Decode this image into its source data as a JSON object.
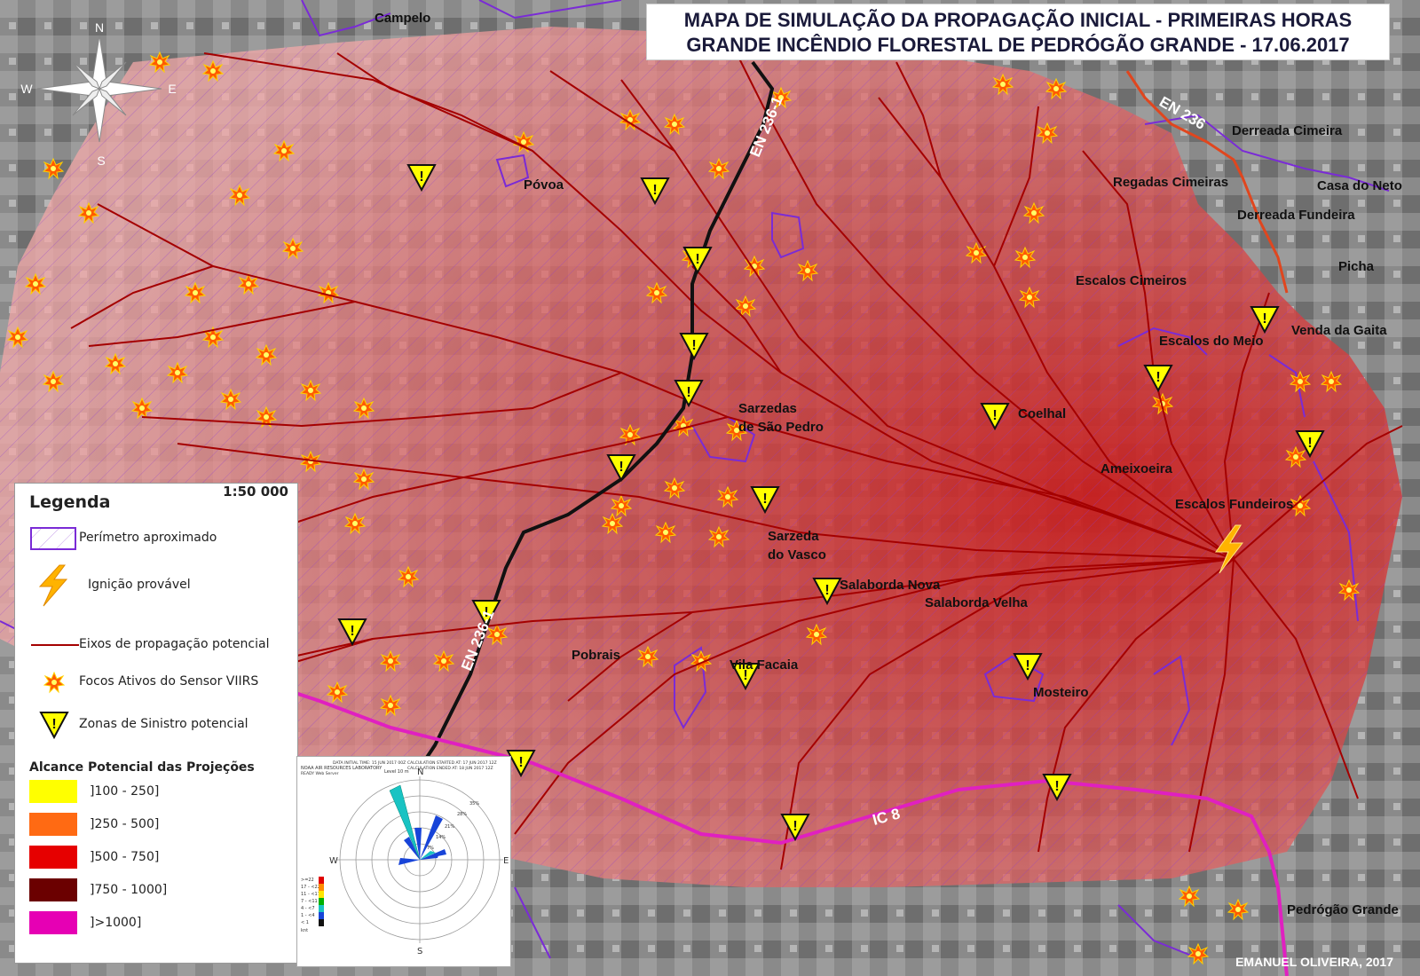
{
  "title": {
    "line1": "MAPA DE SIMULAÇÃO DA PROPAGAÇÃO INICIAL - PRIMEIRAS HORAS",
    "line2": "GRANDE INCÊNDIO FLORESTAL DE PEDRÓGÃO GRANDE - 17.06.2017"
  },
  "compass": {
    "n": "N",
    "s": "S",
    "e": "E",
    "w": "W"
  },
  "places": [
    {
      "name": "Campelo"
    },
    {
      "name": "Póvoa"
    },
    {
      "name": "Derreada Cimeira"
    },
    {
      "name": "Regadas Cimeiras"
    },
    {
      "name": "Casa do Neto"
    },
    {
      "name": "Derreada Fundeira"
    },
    {
      "name": "Picha"
    },
    {
      "name": "Escalos Cimeiros"
    },
    {
      "name": "Escalos do Meio"
    },
    {
      "name": "Venda da Gaita"
    },
    {
      "name": "Sarzedas"
    },
    {
      "name": "de São Pedro"
    },
    {
      "name": "Coelhal"
    },
    {
      "name": "Ameixoeira"
    },
    {
      "name": "Escalos Fundeiros"
    },
    {
      "name": "Sarzeda"
    },
    {
      "name": "do Vasco"
    },
    {
      "name": "Salaborda Nova"
    },
    {
      "name": "Salaborda Velha"
    },
    {
      "name": "Pobrais"
    },
    {
      "name": "Vila Facaia"
    },
    {
      "name": "Mosteiro"
    },
    {
      "name": "Pedrógão Grande"
    }
  ],
  "roads": [
    {
      "label": "EN 236-1"
    },
    {
      "label": "EN 236"
    },
    {
      "label": "EN 236-1"
    },
    {
      "label": "IC 8"
    }
  ],
  "legend": {
    "title": "Legenda",
    "scale": "1:50 000",
    "items": [
      {
        "label": "Perímetro aproximado"
      },
      {
        "label": "Ignição provável"
      },
      {
        "label": "Eixos de propagação potencial"
      },
      {
        "label": "Focos Ativos do Sensor VIIRS"
      },
      {
        "label": "Zonas de Sinistro potencial"
      }
    ],
    "range_title": "Alcance Potencial das Projeções",
    "ranges": [
      {
        "label": "]100 - 250]",
        "color": "#ffff00"
      },
      {
        "label": "]250 - 500]",
        "color": "#ff6a13"
      },
      {
        "label": "]500 - 750]",
        "color": "#e60000"
      },
      {
        "label": "]750 - 1000]",
        "color": "#6b0000"
      },
      {
        "label": "]>1000]",
        "color": "#e600b4"
      }
    ]
  },
  "windrose": {
    "header_left1": "DATA INITIAL TIME: 15 JUN 2017 00Z",
    "header_left2": "NOAA AIR RESOURCES LABORATORY",
    "header_left3": "READY Web Server",
    "header_right1": "CALCULATION STARTED AT: 17 JUN 2017 12Z",
    "header_right2": "CALCULATION ENDED AT: 18 JUN 2017 12Z",
    "level": "Level    10 m",
    "n": "N",
    "s": "S",
    "e": "E",
    "w": "W",
    "rings": [
      "7%",
      "14%",
      "21%",
      "28%",
      "35%"
    ],
    "speed_classes": [
      ">=22",
      "17 - <22",
      "11 - <17",
      "7 - <11",
      "4 - <7",
      "1 - <4",
      "< 1"
    ],
    "unit": "knt"
  },
  "credit": "EMANUEL OLIVEIRA, 2017",
  "colors": {
    "axes": "#a40000",
    "perimeter": "#7a2bd6",
    "road_en": "#111111",
    "road_en236": "#e0461e",
    "road_ic8": "#e020c0",
    "fire_zone": "#d93a3a"
  }
}
